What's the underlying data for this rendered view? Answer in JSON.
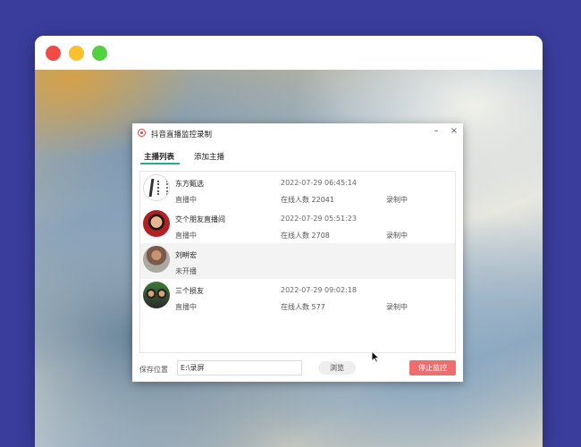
{
  "app": {
    "title": "抖音直播监控录制",
    "minimize_label": "–",
    "close_label": "×"
  },
  "tabs": [
    {
      "label": "主播列表"
    },
    {
      "label": "添加主播"
    }
  ],
  "streamers": [
    {
      "name": "东方甄选",
      "status": "直播中",
      "time": "2022-07-29 06:45:14",
      "viewers": "在线人数 22041",
      "recording": "录制中"
    },
    {
      "name": "交个朋友直播间",
      "status": "直播中",
      "time": "2022-07-29 05:51:23",
      "viewers": "在线人数 2708",
      "recording": "录制中"
    },
    {
      "name": "刘畊宏",
      "status": "未开播",
      "time": "",
      "viewers": "",
      "recording": ""
    },
    {
      "name": "三个损友",
      "status": "直播中",
      "time": "2022-07-29 09:02:18",
      "viewers": "在线人数 577",
      "recording": "录制中"
    }
  ],
  "footer": {
    "save_label": "保存位置",
    "save_path": "E:\\录屏",
    "browse_label": "浏览",
    "stop_label": "停止监控"
  },
  "colors": {
    "accent": "#22b07d",
    "stop_button": "#ee6e6e",
    "logo": "#e0413f",
    "background": "#3a3d9c"
  }
}
